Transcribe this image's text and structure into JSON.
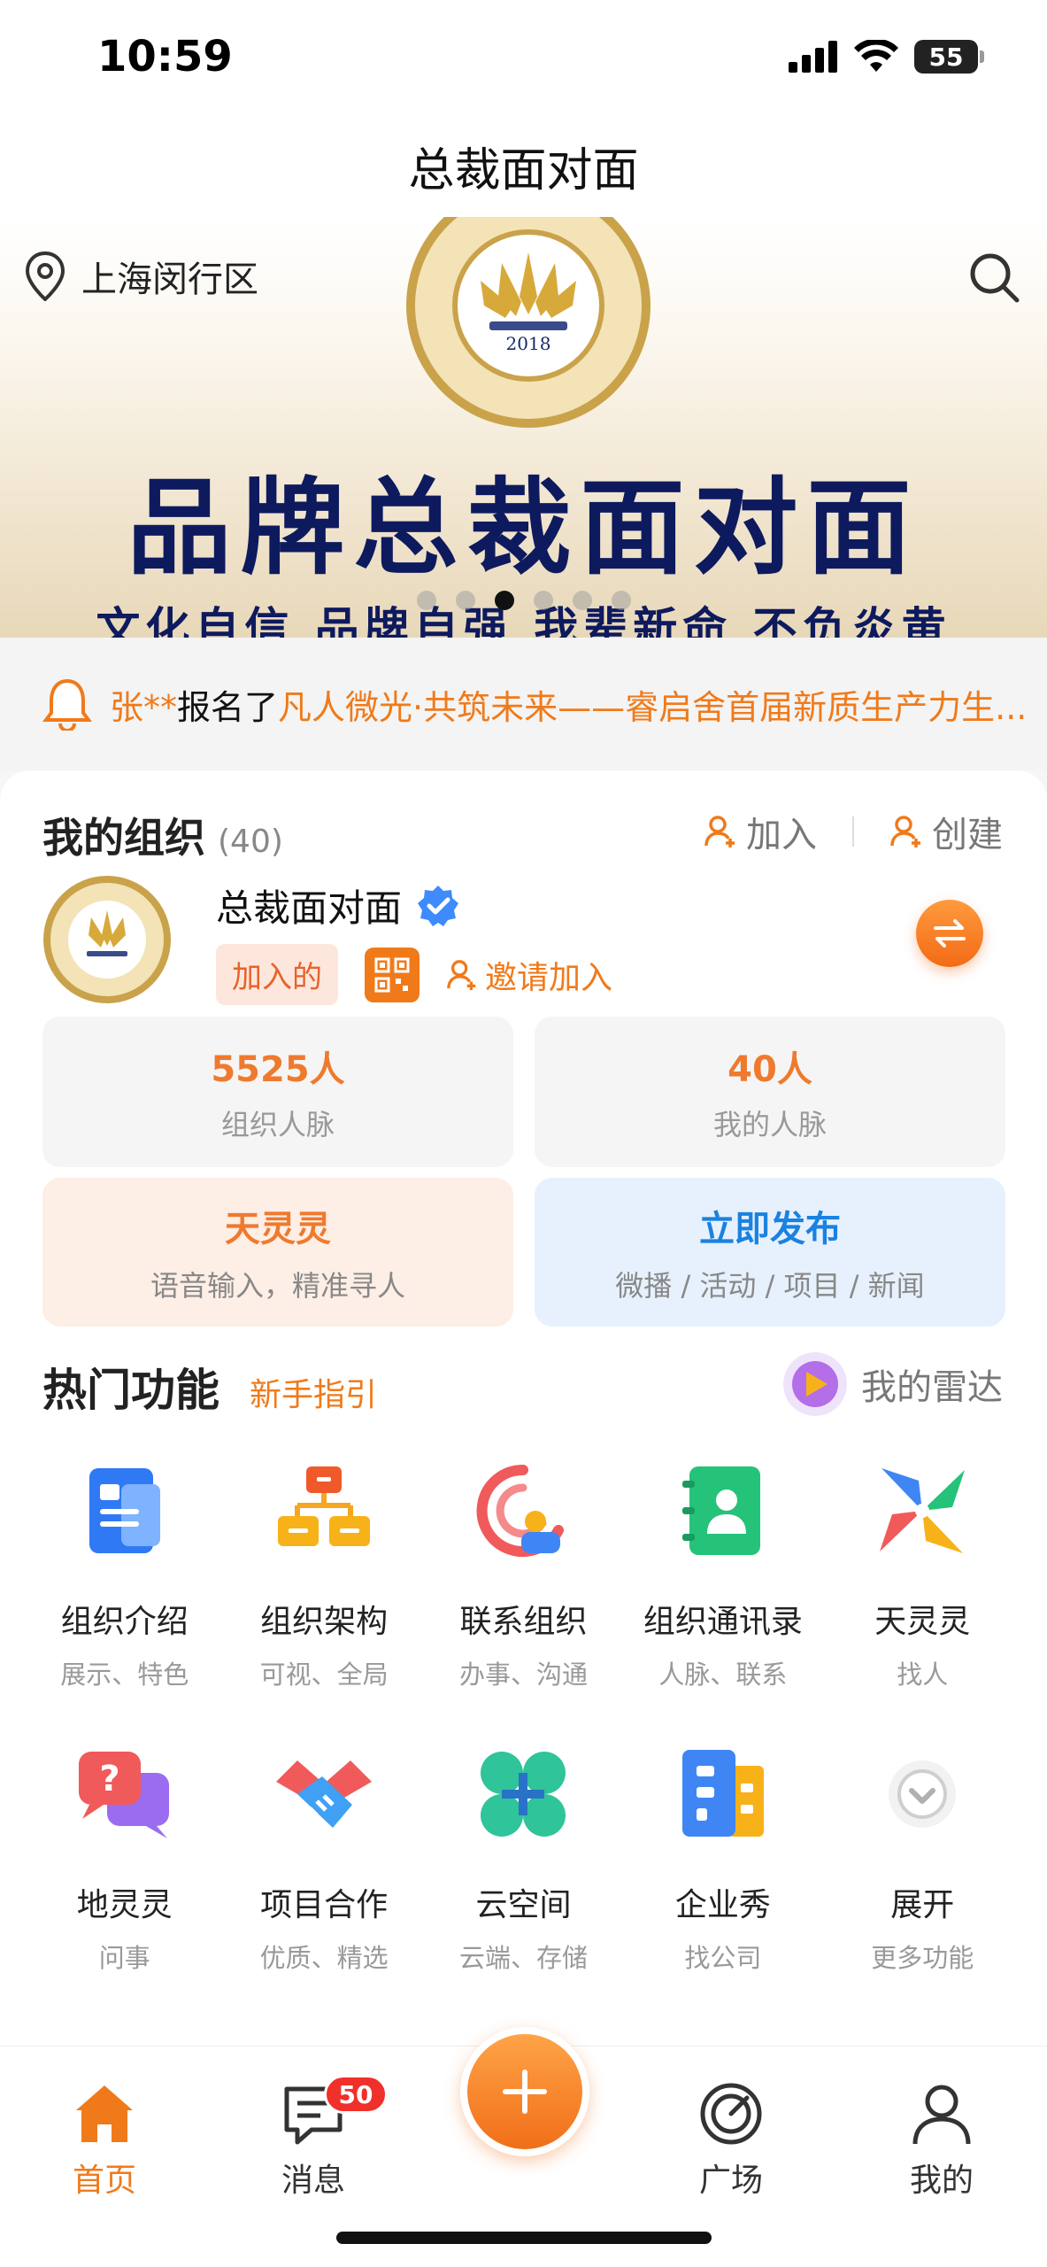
{
  "status_bar": {
    "time": "10:59",
    "battery": "55"
  },
  "title": "总裁面对面",
  "banner": {
    "location": "上海闵行区",
    "headline": "品牌总裁面对面",
    "subline": "文化自信 品牌自强 我辈新命 不负炎黄",
    "slide_count": 6,
    "active_slide": 3,
    "emblem_year": "2018"
  },
  "notice": {
    "user": "张**",
    "action": "报名了",
    "event": "凡人微光·共筑未来——睿启舍首届新质生产力生..."
  },
  "org": {
    "title": "我的组织",
    "count": "(40)",
    "join_label": "加入",
    "create_label": "创建",
    "name": "总裁面对面",
    "joined_tag": "加入的",
    "invite_label": "邀请加入",
    "stats": [
      {
        "value": "5525人",
        "label": "组织人脉"
      },
      {
        "value": "40人",
        "label": "我的人脉"
      }
    ],
    "features": [
      {
        "title": "天灵灵",
        "subtitle": "语音输入，精准寻人"
      },
      {
        "title": "立即发布",
        "subtitle": "微播 / 活动 / 项目 / 新闻"
      }
    ]
  },
  "hot": {
    "title": "热门功能",
    "guide": "新手指引",
    "radar": "我的雷达",
    "items": [
      {
        "label": "组织介绍",
        "sub": "展示、特色",
        "icon": "org-intro-icon"
      },
      {
        "label": "组织架构",
        "sub": "可视、全局",
        "icon": "org-structure-icon"
      },
      {
        "label": "联系组织",
        "sub": "办事、沟通",
        "icon": "contact-org-icon"
      },
      {
        "label": "组织通讯录",
        "sub": "人脉、联系",
        "icon": "address-book-icon"
      },
      {
        "label": "天灵灵",
        "sub": "找人",
        "icon": "pinwheel-icon"
      },
      {
        "label": "地灵灵",
        "sub": "问事",
        "icon": "question-chat-icon"
      },
      {
        "label": "项目合作",
        "sub": "优质、精选",
        "icon": "handshake-icon"
      },
      {
        "label": "云空间",
        "sub": "云端、存储",
        "icon": "cloud-space-icon"
      },
      {
        "label": "企业秀",
        "sub": "找公司",
        "icon": "company-building-icon"
      },
      {
        "label": "展开",
        "sub": "更多功能",
        "icon": "expand-chevron-icon"
      }
    ]
  },
  "nav": {
    "home": "首页",
    "messages": "消息",
    "messages_badge": "50",
    "plaza": "广场",
    "mine": "我的"
  },
  "colors": {
    "accent": "#f07a1a",
    "blue": "#1a82e0",
    "navy": "#0e1a5e"
  }
}
